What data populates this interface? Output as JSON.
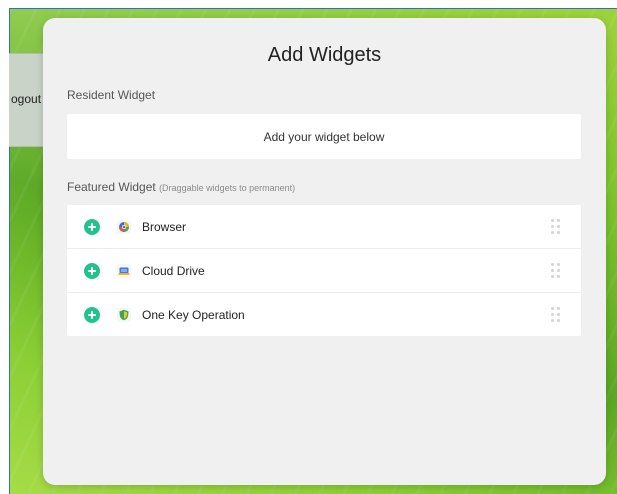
{
  "background_panel": {
    "logout_label": "ogout"
  },
  "modal": {
    "title": "Add Widgets",
    "resident": {
      "label": "Resident Widget",
      "empty_text": "Add your widget below"
    },
    "featured": {
      "label": "Featured Widget",
      "hint": "(Draggable widgets to permanent)",
      "items": [
        {
          "name": "Browser",
          "icon": "browser-icon"
        },
        {
          "name": "Cloud Drive",
          "icon": "cloud-drive-icon"
        },
        {
          "name": "One Key Operation",
          "icon": "one-key-operation-icon"
        }
      ]
    }
  },
  "colors": {
    "accent": "#22c38a",
    "modal_bg": "#f0f0f0"
  }
}
